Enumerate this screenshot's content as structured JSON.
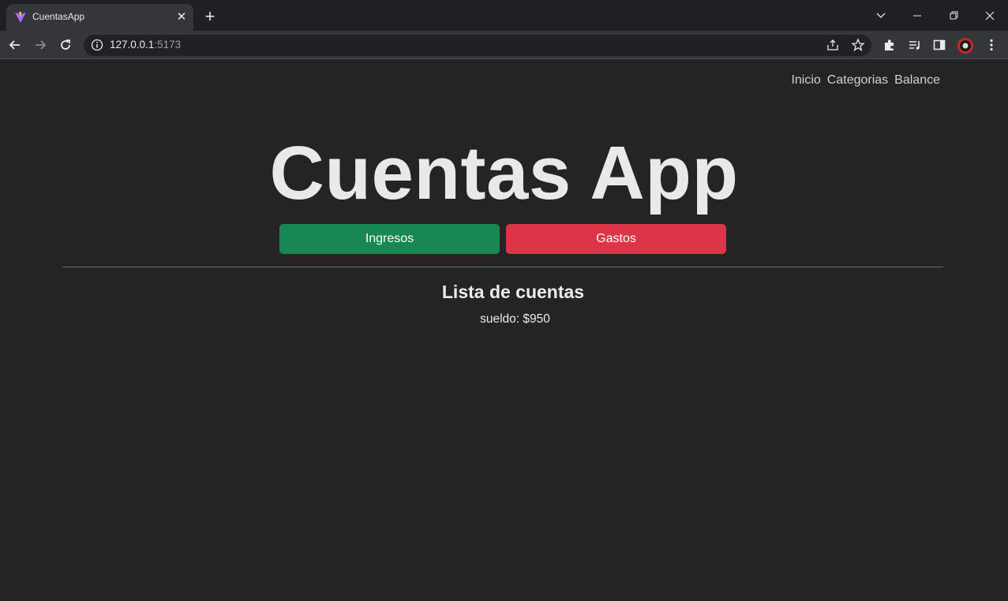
{
  "browser": {
    "tab_title": "CuentasApp",
    "url_host": "127.0.0.1",
    "url_port": ":5173"
  },
  "nav": {
    "links": [
      "Inicio",
      "Categorias",
      "Balance"
    ]
  },
  "header": {
    "title": "Cuentas App",
    "income_button": "Ingresos",
    "expense_button": "Gastos"
  },
  "list": {
    "title": "Lista de cuentas",
    "items": [
      {
        "name": "sueldo",
        "amount": "$950"
      }
    ]
  },
  "colors": {
    "background": "#242424",
    "income": "#198754",
    "expense": "#dc3545"
  }
}
